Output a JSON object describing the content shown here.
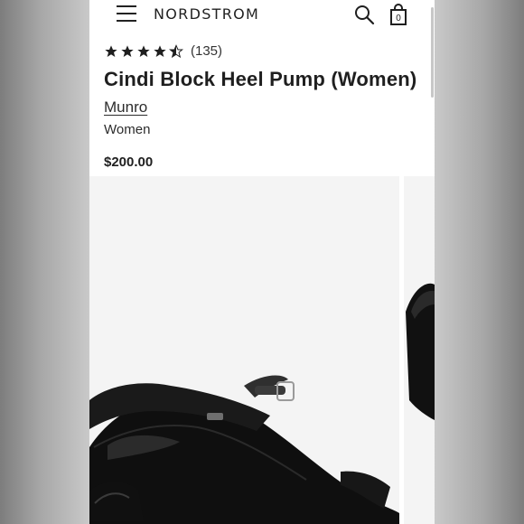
{
  "header": {
    "brand": "NORDSTROM",
    "bag_count": "0",
    "menu_icon": "hamburger-menu-icon",
    "search_icon": "search-icon",
    "bag_icon": "shopping-bag-icon"
  },
  "product": {
    "rating": 4.5,
    "rating_max": 5,
    "review_count": "(135)",
    "title": "Cindi Block Heel Pump (Women)",
    "brand": "Munro",
    "category": "Women",
    "price": "$200.00"
  },
  "gallery": {
    "main_image": "black-block-heel-pump-photo",
    "next_image": "black-pump-photo-partial"
  },
  "colors": {
    "text": "#1f1f1f",
    "star": "#1f1f1f",
    "image_bg": "#f4f4f4"
  }
}
